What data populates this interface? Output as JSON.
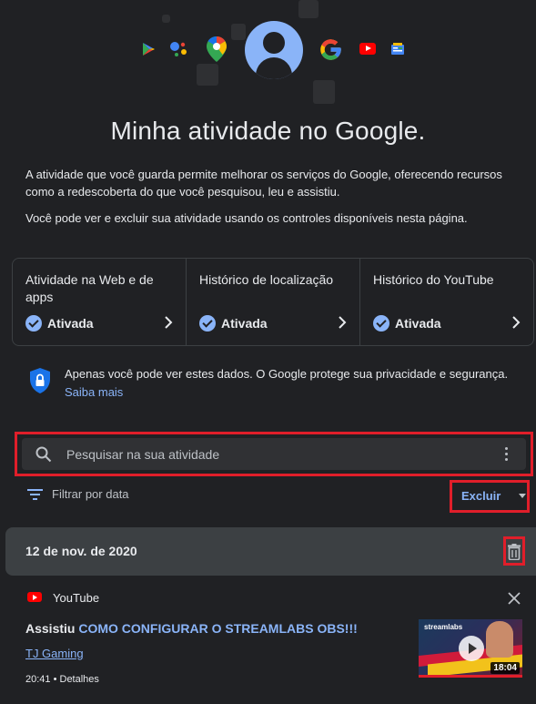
{
  "page": {
    "title": "Minha atividade no Google.",
    "intro_1": "A atividade que você guarda permite melhorar os serviços do Google, oferecendo recursos como a redescoberta do que você pesquisou, leu e assistiu.",
    "intro_2": "Você pode ver e excluir sua atividade usando os controles disponíveis nesta página."
  },
  "hero_icons": [
    "play-store-icon",
    "assistant-icon",
    "maps-icon",
    "avatar",
    "google-icon",
    "youtube-icon",
    "news-icon"
  ],
  "controls": [
    {
      "title": "Atividade na Web e de apps",
      "status": "Ativada"
    },
    {
      "title": "Histórico de localização",
      "status": "Ativada"
    },
    {
      "title": "Histórico do YouTube",
      "status": "Ativada"
    }
  ],
  "privacy": {
    "text": "Apenas você pode ver estes dados. O Google protege sua privacidade e segurança.",
    "link": "Saiba mais"
  },
  "search": {
    "placeholder": "Pesquisar na sua atividade"
  },
  "filter": {
    "label": "Filtrar por data"
  },
  "delete": {
    "label": "Excluir"
  },
  "date_group": {
    "label": "12 de nov. de 2020"
  },
  "entry": {
    "service": "YouTube",
    "action": "Assistiu ",
    "video_title": "COMO CONFIGURAR O STREAMLABS OBS!!!",
    "channel": "TJ Gaming",
    "time": "20:41",
    "separator": " • ",
    "details": "Detalhes",
    "thumbnail": {
      "brand": "streamlabs",
      "duration": "18:04"
    }
  },
  "colors": {
    "background": "#202124",
    "accent": "#8ab4f8",
    "highlight_border": "#e01e2a",
    "youtube_red": "#ff0000"
  }
}
